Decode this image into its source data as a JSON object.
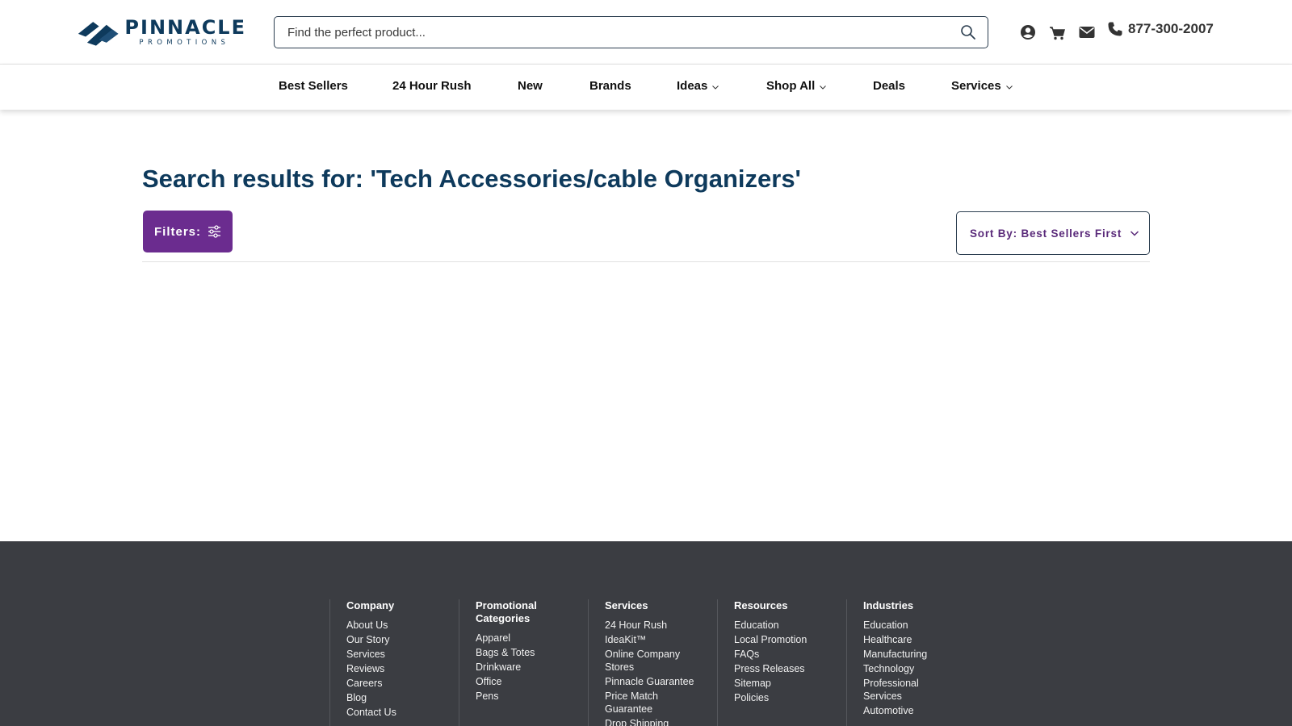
{
  "brand": {
    "name": "PINNACLE",
    "sub": "PROMOTIONS",
    "color": "#0e3a5c",
    "accent": "#6b2c8f"
  },
  "search": {
    "placeholder": "Find the perfect product...",
    "icon": "search-icon"
  },
  "header": {
    "phone": "877-300-2007",
    "icons": [
      "account-icon",
      "cart-icon",
      "mail-icon",
      "phone-icon"
    ]
  },
  "nav": {
    "items": [
      {
        "label": "Best Sellers"
      },
      {
        "label": "24 Hour Rush"
      },
      {
        "label": "New"
      },
      {
        "label": "Brands"
      },
      {
        "label": "Ideas"
      },
      {
        "label": "Shop All"
      },
      {
        "label": "Deals"
      },
      {
        "label": "Services"
      }
    ]
  },
  "main": {
    "title": "Search results for: 'Tech Accessories/cable Organizers'",
    "filters_label": "Filters:",
    "sort_label": "Sort By: Best Sellers First"
  },
  "footer": {
    "columns": [
      {
        "title": "Company",
        "links": [
          "About Us",
          "Our Story",
          "Services",
          "Reviews",
          "Careers",
          "Blog",
          "Contact Us"
        ]
      },
      {
        "title": "Promotional Categories",
        "links": [
          "Apparel",
          "Bags & Totes",
          "Drinkware",
          "Office",
          "Pens"
        ]
      },
      {
        "title": "Services",
        "links": [
          "24 Hour Rush",
          "IdeaKit™",
          "Online Company Stores",
          "Pinnacle Guarantee",
          "Price Match Guarantee",
          "Drop Shipping"
        ]
      },
      {
        "title": "Resources",
        "links": [
          "Education",
          "Local Promotion",
          "FAQs",
          "Press Releases",
          "Sitemap",
          "Policies"
        ]
      },
      {
        "title": "Industries",
        "links": [
          "Education",
          "Healthcare",
          "Manufacturing",
          "Technology",
          "Professional Services",
          "Automotive"
        ]
      }
    ]
  }
}
